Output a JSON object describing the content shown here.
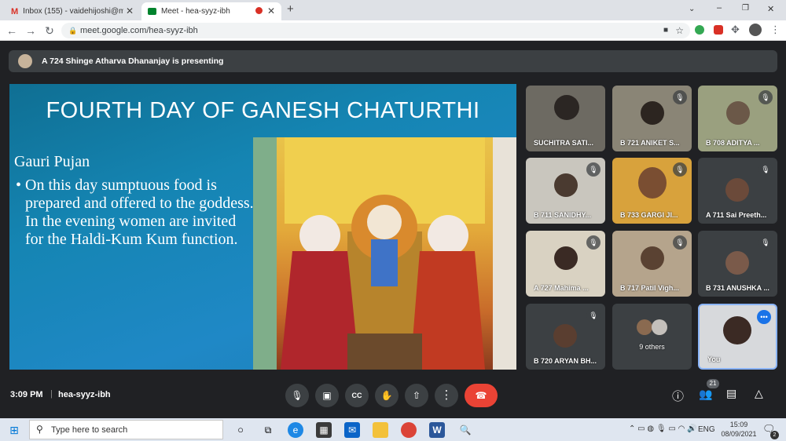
{
  "browser": {
    "tabs": [
      {
        "title": "Inbox (155) - vaidehijoshi@mes.a",
        "icon": "gmail-icon"
      },
      {
        "title": "Meet - hea-syyz-ibh",
        "icon": "meet-icon"
      }
    ],
    "new_tab": "+",
    "url": "meet.google.com/hea-syyz-ibh",
    "window_controls": [
      "⌄",
      "–",
      "❐",
      "✕"
    ]
  },
  "meet": {
    "presenter_text": "A 724 Shinge Atharva Dhananjay is presenting",
    "slide": {
      "title": "FOURTH DAY OF GANESH CHATURTHI",
      "subtitle": "Gauri Pujan",
      "body": "• On this day sumptuous food is prepared and offered to the goddess. In the evening women are invited for the Haldi-Kum Kum function."
    },
    "participants": [
      {
        "name": "SUCHITRA SATI...",
        "muted": false
      },
      {
        "name": "B 721 ANIKET S...",
        "muted": true
      },
      {
        "name": "B 708 ADITYA ...",
        "muted": true
      },
      {
        "name": "B 711 SANIDHY...",
        "muted": true
      },
      {
        "name": "B 733 GARGI JI...",
        "muted": true
      },
      {
        "name": "A 711 Sai Preeth...",
        "muted": true
      },
      {
        "name": "A 727 Mahima ...",
        "muted": true
      },
      {
        "name": "B 717 Patil Vigh...",
        "muted": true
      },
      {
        "name": "B 731 ANUSHKA ...",
        "muted": true
      },
      {
        "name": "B 720 ARYAN BH...",
        "muted": true
      },
      {
        "name": "9 others",
        "muted": false
      },
      {
        "name": "You",
        "muted": false
      }
    ],
    "time": "3:09 PM",
    "separator": "|",
    "meeting_code": "hea-syyz-ibh",
    "participant_count": "21",
    "controls": [
      "mic-icon",
      "camera-icon",
      "captions-icon",
      "raise-hand-icon",
      "present-icon",
      "more-icon",
      "end-call-icon"
    ],
    "colors": {
      "end_call": "#ea4335",
      "accent": "#8ab4f8"
    }
  },
  "taskbar": {
    "search_placeholder": "Type here to search",
    "lang": "ENG",
    "clock_time": "15:09",
    "clock_date": "08/09/2021",
    "notifications": "2"
  }
}
